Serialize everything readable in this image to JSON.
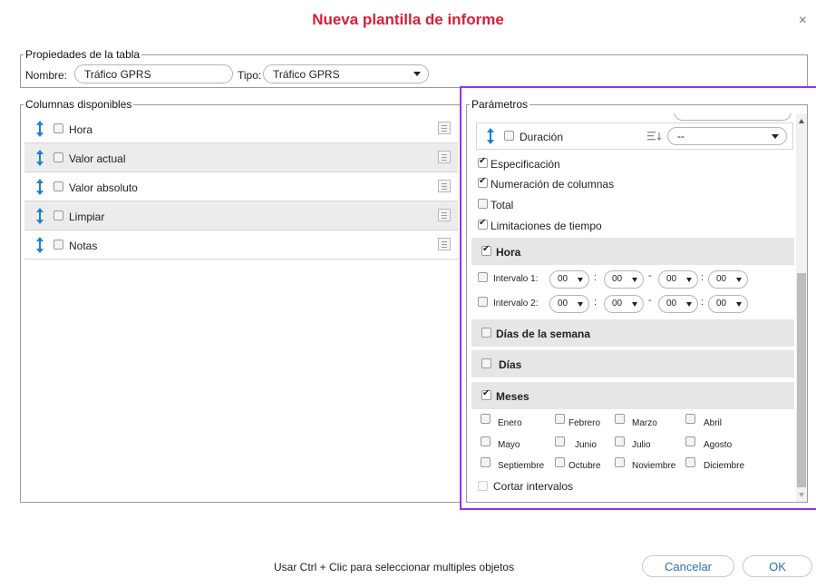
{
  "dialog": {
    "title": "Nueva plantilla de informe"
  },
  "table_props": {
    "legend": "Propiedades de la tabla",
    "name_label": "Nombre:",
    "name_value": "Tráfico GPRS",
    "type_label": "Tipo:",
    "type_value": "Tráfico GPRS"
  },
  "columns": {
    "legend": "Columnas disponibles",
    "items": [
      {
        "label": "Hora"
      },
      {
        "label": "Valor actual"
      },
      {
        "label": "Valor absoluto"
      },
      {
        "label": "Limpiar"
      },
      {
        "label": "Notas"
      }
    ]
  },
  "params": {
    "legend": "Parámetros",
    "duration_label": "Duración",
    "duration_value": "--",
    "checks": [
      {
        "label": "Especificación",
        "checked": true
      },
      {
        "label": "Numeración de columnas",
        "checked": true
      },
      {
        "label": "Total",
        "checked": false
      },
      {
        "label": "Limitaciones de tiempo",
        "checked": true
      }
    ],
    "hour_section": "Hora",
    "interval1_label": "Intervalo 1:",
    "interval2_label": "Intervalo 2:",
    "time_value": "00",
    "colon": ":",
    "dash": "-",
    "weekdays_section": "Días de la semana",
    "days_section": "Días",
    "months_section": "Meses",
    "months": [
      "Enero",
      "Febrero",
      "Marzo",
      "Abril",
      "Mayo",
      "Junio",
      "Julio",
      "Agosto",
      "Septiembre",
      "Octubre",
      "Noviembre",
      "Diciembre"
    ],
    "cut_intervals": "Cortar intervalos"
  },
  "footer": {
    "hint": "Usar Ctrl + Clic para seleccionar multiples objetos",
    "cancel": "Cancelar",
    "ok": "OK"
  },
  "colors": {
    "title": "#d6203a",
    "drag_icon": "#1f7fd1",
    "highlight_border": "#9b30e0",
    "button_text": "#2a6fb5"
  }
}
